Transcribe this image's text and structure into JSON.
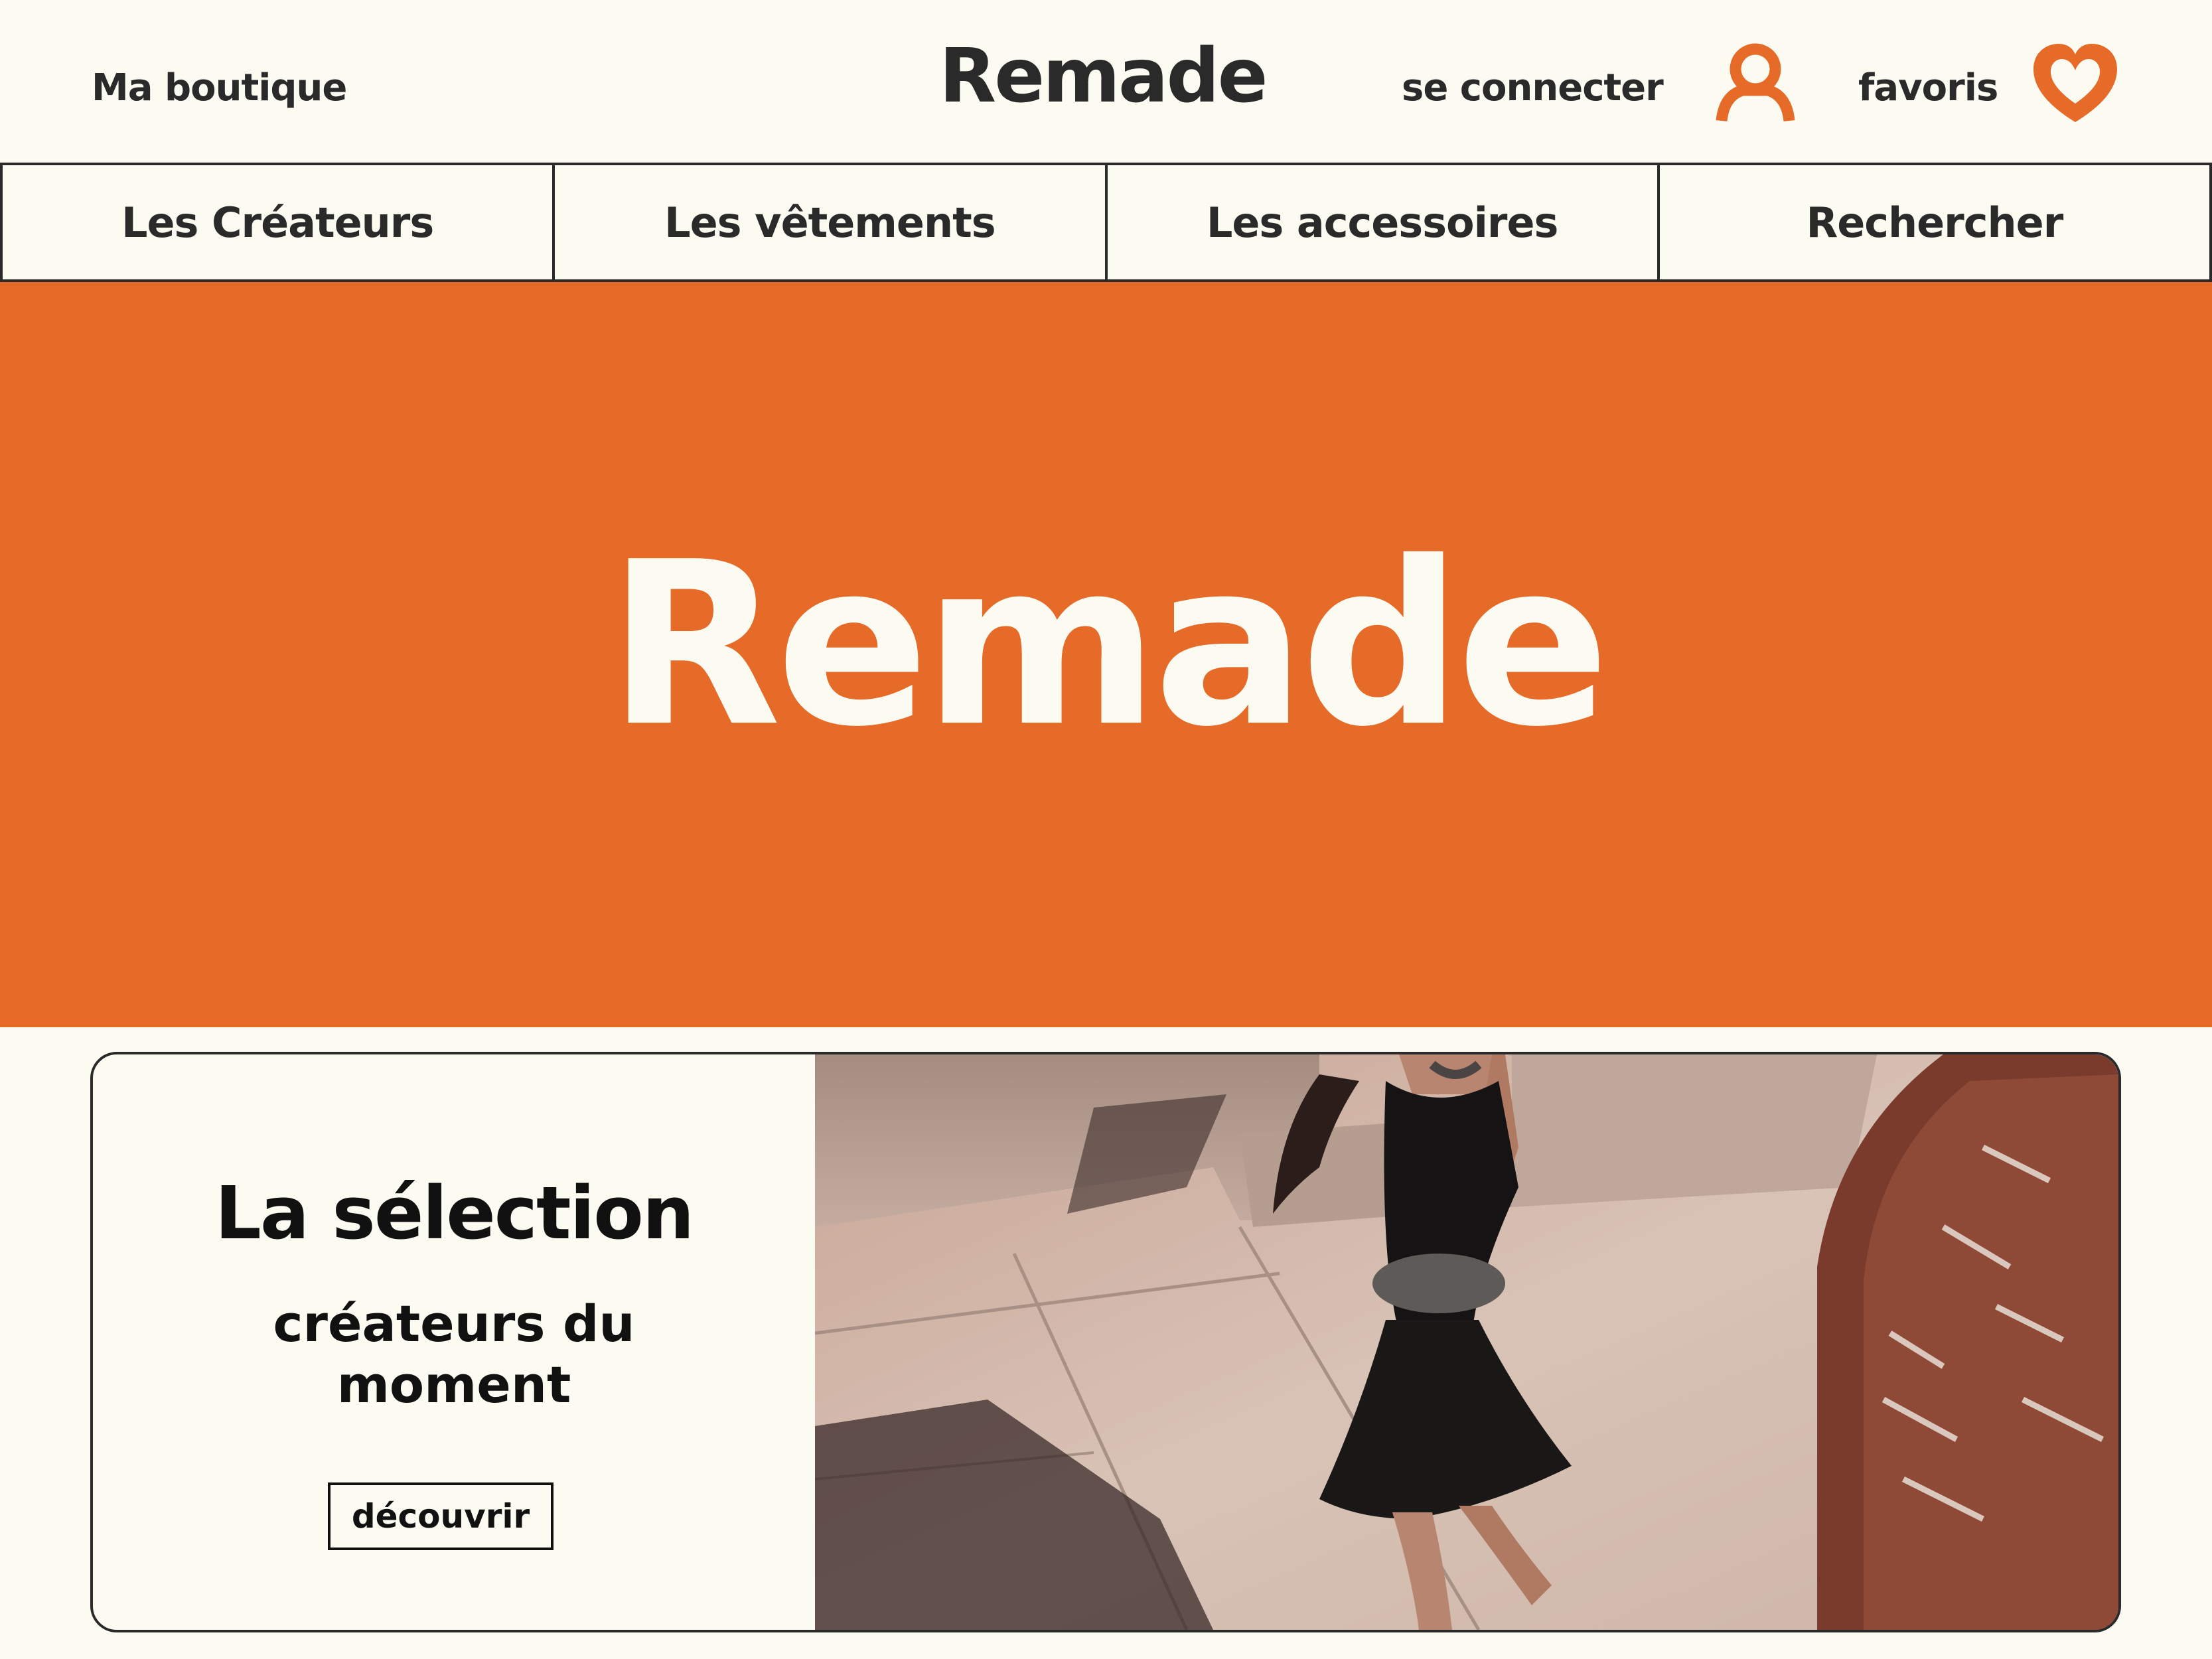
{
  "header": {
    "shop_label": "Ma boutique",
    "brand": "Remade",
    "login_label": "se connecter",
    "login_icon": "user-icon",
    "favorites_label": "favoris",
    "favorites_icon": "heart-icon"
  },
  "nav": {
    "items": [
      {
        "label": "Les Créateurs"
      },
      {
        "label": "Les vêtements"
      },
      {
        "label": "Les accessoires"
      },
      {
        "label": "Rechercher"
      }
    ]
  },
  "hero": {
    "title": "Remade"
  },
  "selection": {
    "title": "La sélection",
    "subtitle_line1": "créateurs du",
    "subtitle_line2": "moment",
    "button_label": "découvrir"
  },
  "colors": {
    "accent": "#e66a28",
    "background": "#fcfbf2",
    "text": "#2a2a2a"
  }
}
